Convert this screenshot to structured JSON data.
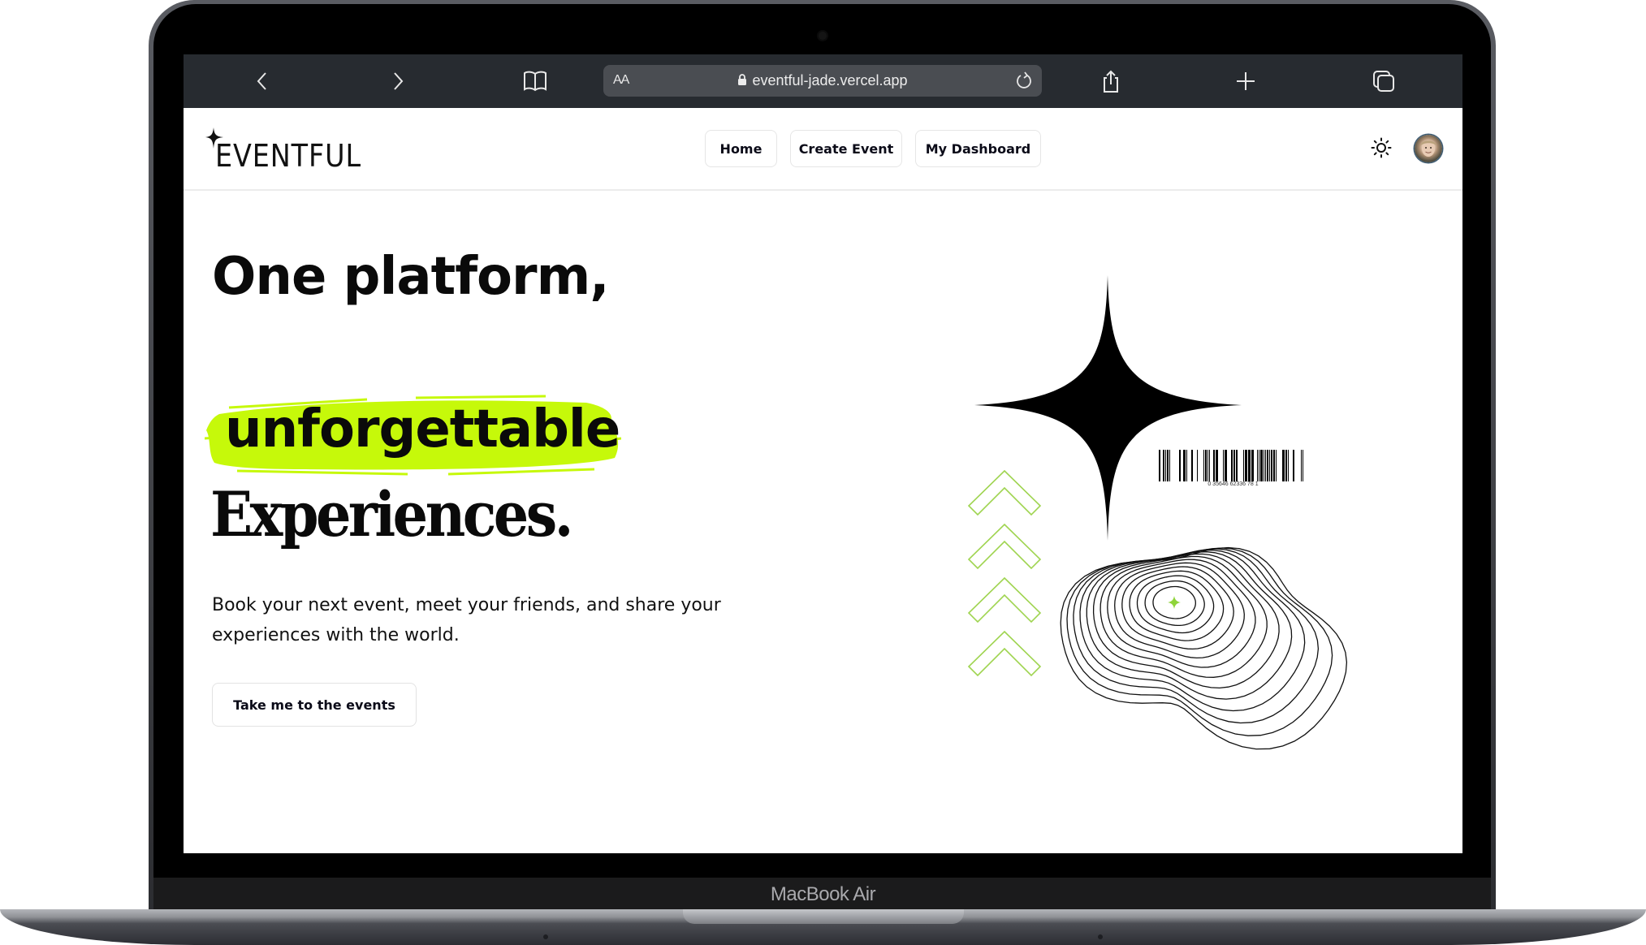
{
  "device": {
    "model_label": "MacBook Air"
  },
  "browser": {
    "reader_label": "AA",
    "url": "eventful-jade.vercel.app",
    "icons": [
      "back-icon",
      "forward-icon",
      "bookmarks-icon",
      "lock-icon",
      "reload-icon",
      "share-icon",
      "new-tab-icon",
      "tabs-icon"
    ]
  },
  "site": {
    "logo_text": "EVENTFUL",
    "nav": [
      {
        "label": "Home"
      },
      {
        "label": "Create Event"
      },
      {
        "label": "My Dashboard"
      }
    ],
    "theme_toggle_icon": "sun-icon",
    "avatar_icon": "user-avatar"
  },
  "hero": {
    "line1": "One platform,",
    "line2_highlight": "unforgettable",
    "line3": "Experiences.",
    "subtitle": "Book your next event, meet your friends, and share your experiences with the world.",
    "cta_label": "Take me to the events"
  },
  "illustration": {
    "barcode_number": "0 35646 62336 78 1",
    "accent_color": "#c6f90a",
    "chevron_color": "#9fd450"
  }
}
